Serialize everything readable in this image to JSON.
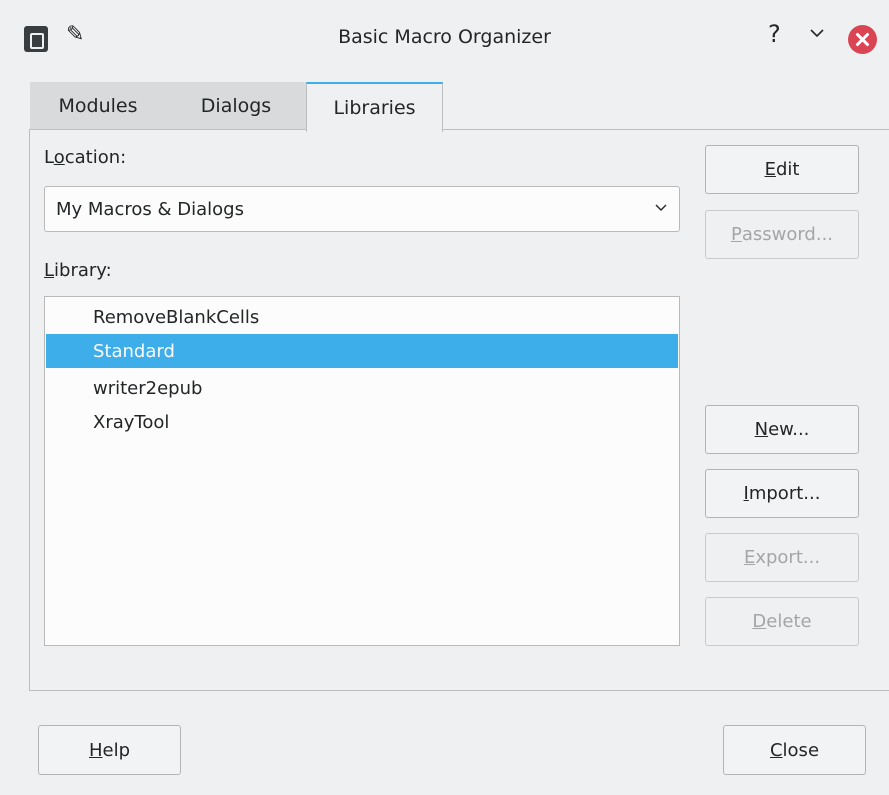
{
  "window": {
    "title": "Basic Macro Organizer",
    "help_glyph": "?",
    "icons": [
      "app-icon",
      "pin-icon",
      "help-icon",
      "chevron-down-icon",
      "close-icon"
    ],
    "close_color": "#da4453"
  },
  "tabs": [
    {
      "label": "Modules",
      "active": false
    },
    {
      "label": "Dialogs",
      "active": false
    },
    {
      "label": "Libraries",
      "active": true
    }
  ],
  "location": {
    "label_pre": "L",
    "label_mnemonic": "o",
    "label_post": "cation:",
    "value": "My Macros & Dialogs"
  },
  "library": {
    "label_mnemonic": "L",
    "label_post": "ibrary:",
    "items": [
      {
        "label": "RemoveBlankCells",
        "selected": false
      },
      {
        "label": "Standard",
        "selected": true
      },
      {
        "label": "writer2epub",
        "selected": false
      },
      {
        "label": "XrayTool",
        "selected": false
      }
    ]
  },
  "buttons": {
    "edit": {
      "mnemonic": "E",
      "rest": "dit",
      "enabled": true
    },
    "password": {
      "mnemonic": "P",
      "rest": "assword...",
      "enabled": false
    },
    "new": {
      "mnemonic": "N",
      "rest": "ew...",
      "enabled": true
    },
    "import": {
      "mnemonic": "I",
      "rest": "mport...",
      "enabled": true
    },
    "export": {
      "mnemonic": "E",
      "rest": "xport...",
      "enabled": false
    },
    "delete": {
      "mnemonic": "D",
      "rest": "elete",
      "enabled": false
    },
    "help": {
      "mnemonic": "H",
      "rest": "elp",
      "enabled": true
    },
    "close": {
      "mnemonic": "C",
      "rest": "lose",
      "enabled": true
    }
  },
  "colors": {
    "accent": "#3daee9",
    "background": "#eff0f1"
  }
}
